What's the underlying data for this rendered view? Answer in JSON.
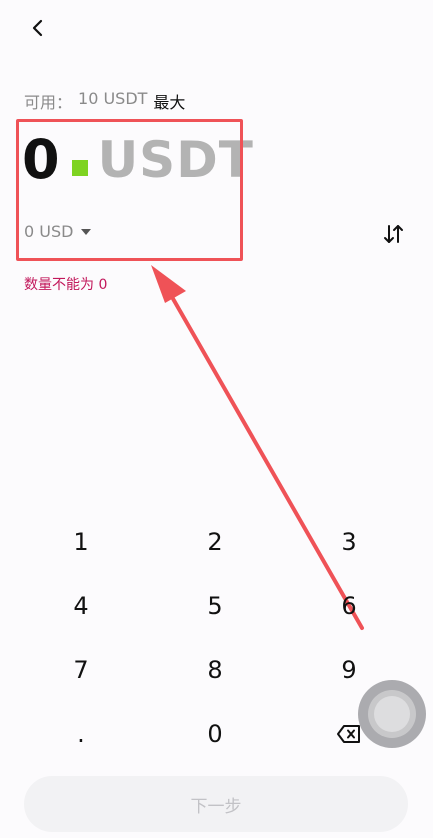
{
  "available": {
    "label": "可用：",
    "value": "10 USDT",
    "max_label": "最大"
  },
  "amount": {
    "value": "0",
    "unit": "USDT"
  },
  "fiat": {
    "value": "0 USD"
  },
  "error": {
    "text": "数量不能为 0"
  },
  "keypad": {
    "keys": [
      "1",
      "2",
      "3",
      "4",
      "5",
      "6",
      "7",
      "8",
      "9",
      ".",
      "0"
    ]
  },
  "next_button": {
    "label": "下一步"
  },
  "colors": {
    "cursor": "#7ed321",
    "error": "#c2185b",
    "annotation": "#ef5257"
  }
}
